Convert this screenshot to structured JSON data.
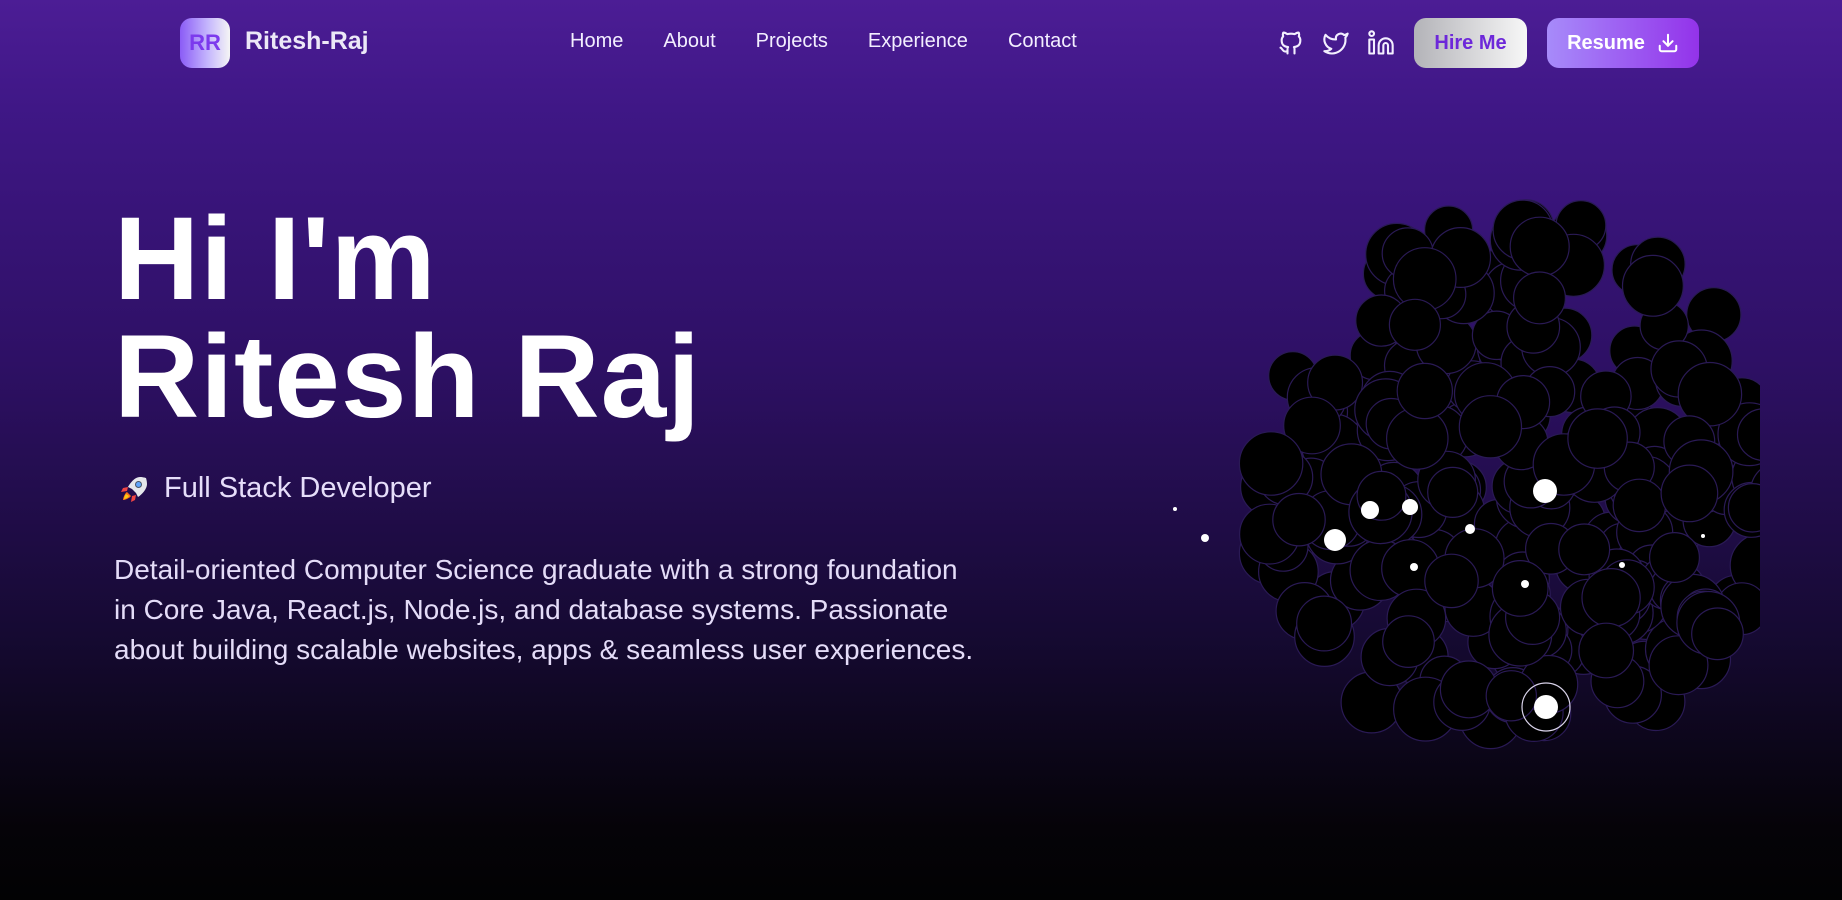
{
  "brand": {
    "initials": "RR",
    "name": "Ritesh-Raj"
  },
  "nav": {
    "items": [
      "Home",
      "About",
      "Projects",
      "Experience",
      "Contact"
    ]
  },
  "social": {
    "icons": [
      "github-icon",
      "twitter-icon",
      "linkedin-icon"
    ]
  },
  "actions": {
    "hire_label": "Hire Me",
    "resume_label": "Resume"
  },
  "hero": {
    "greeting": "Hi I'm",
    "name": "Ritesh Raj",
    "role_icon": "rocket-icon",
    "role": "Full Stack Developer",
    "description": "Detail-oriented Computer Science graduate with a strong foundation in Core Java, React.js, Node.js, and database systems. Passionate about building scalable websites, apps & seamless user experiences."
  },
  "colors": {
    "accent": "#7c3aed",
    "accent_light": "#a78bfa",
    "background_top": "#4c1d95",
    "background_bottom": "#020203"
  }
}
